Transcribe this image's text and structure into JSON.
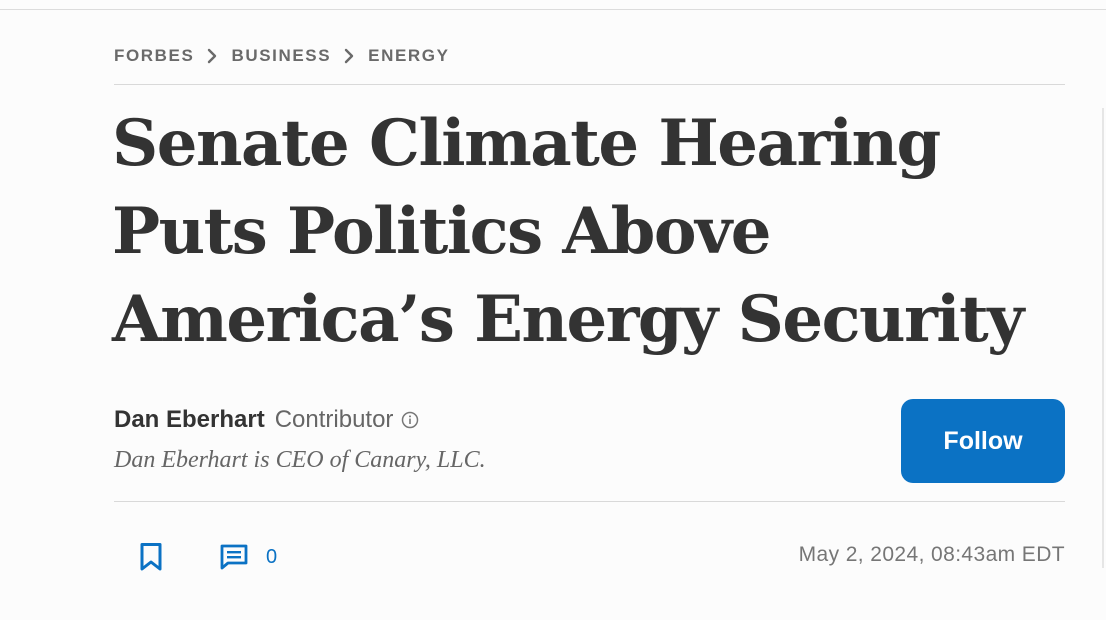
{
  "breadcrumb": {
    "items": [
      "FORBES",
      "BUSINESS",
      "ENERGY"
    ]
  },
  "article": {
    "headline_lines": [
      "Senate Climate Hearing",
      "Puts Politics Above",
      "America’s Energy Security"
    ]
  },
  "author": {
    "name": "Dan Eberhart",
    "role": "Contributor",
    "bio": "Dan Eberhart is CEO of Canary, LLC."
  },
  "follow": {
    "label": "Follow"
  },
  "actions": {
    "comment_count": "0"
  },
  "timestamp": "May 2, 2024, 08:43am EDT",
  "icons": {
    "breadcrumb_separator": "chevron-right-icon",
    "author_info": "info-icon",
    "bookmark": "bookmark-icon",
    "comments": "comment-icon"
  },
  "colors": {
    "accent": "#0b72c4",
    "text": "#333333",
    "muted": "#666666",
    "breadcrumb": "#6a6a6a",
    "rule": "#d9d9d9"
  }
}
